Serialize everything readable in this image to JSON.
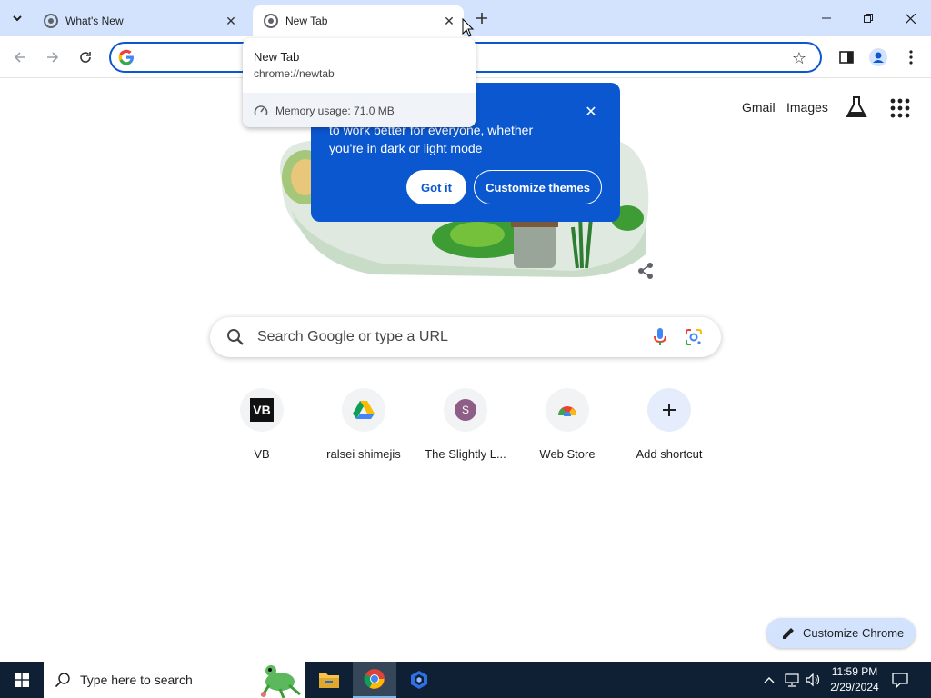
{
  "browser": {
    "tabs": [
      {
        "title": "What's New",
        "active": false
      },
      {
        "title": "New Tab",
        "active": true
      }
    ],
    "omnibox": {
      "value": "",
      "placeholder": ""
    }
  },
  "hovercard": {
    "title": "New Tab",
    "url": "chrome://newtab",
    "memory": "Memory usage: 71.0 MB"
  },
  "promo": {
    "text": "e been refreshed\nto work better for everyone, whether\nyou're in dark or light mode",
    "got_it": "Got it",
    "customize_themes": "Customize themes"
  },
  "ntp": {
    "gmail": "Gmail",
    "images": "Images",
    "search_placeholder": "Search Google or type a URL",
    "shortcuts": [
      {
        "label": "VB",
        "icon": "vb-logo-icon"
      },
      {
        "label": "ralsei shimejis",
        "icon": "google-drive-icon"
      },
      {
        "label": "The Slightly L...",
        "icon": "letter-s-avatar-icon",
        "letter": "S"
      },
      {
        "label": "Web Store",
        "icon": "chrome-web-store-icon"
      },
      {
        "label": "Add shortcut",
        "icon": "plus-icon"
      }
    ],
    "customize_chrome": "Customize Chrome"
  },
  "taskbar": {
    "search_text": "Type here to search",
    "time": "11:59 PM",
    "date": "2/29/2024"
  },
  "colors": {
    "accent": "#0b57d0",
    "tabstrip": "#d3e3fd",
    "taskbar": "#0f2034"
  }
}
